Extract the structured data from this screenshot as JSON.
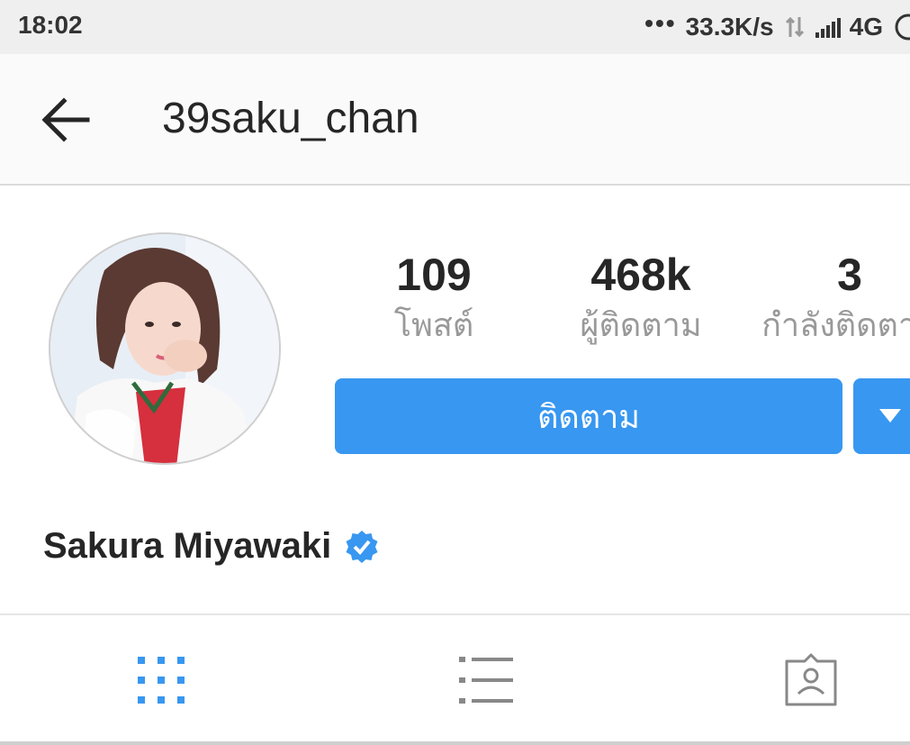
{
  "status_bar": {
    "time": "18:02",
    "network_speed": "33.3K/s",
    "network_type": "4G"
  },
  "header": {
    "username": "39saku_chan",
    "back_icon": "arrow-left-icon"
  },
  "profile": {
    "display_name": "Sakura Miyawaki",
    "verified": true,
    "stats": [
      {
        "value": "109",
        "label": "โพสต์"
      },
      {
        "value": "468k",
        "label": "ผู้ติดตาม"
      },
      {
        "value": "3",
        "label": "กำลังติดตาม"
      }
    ],
    "follow_label": "ติดตาม"
  },
  "tabs": [
    {
      "icon": "grid-icon",
      "active": true
    },
    {
      "icon": "list-icon",
      "active": false
    },
    {
      "icon": "tagged-icon",
      "active": false
    }
  ],
  "colors": {
    "accent": "#3897f0",
    "text": "#262626",
    "muted": "#999999",
    "status_bar_bg": "#efefef",
    "header_bg": "#fafafa"
  }
}
